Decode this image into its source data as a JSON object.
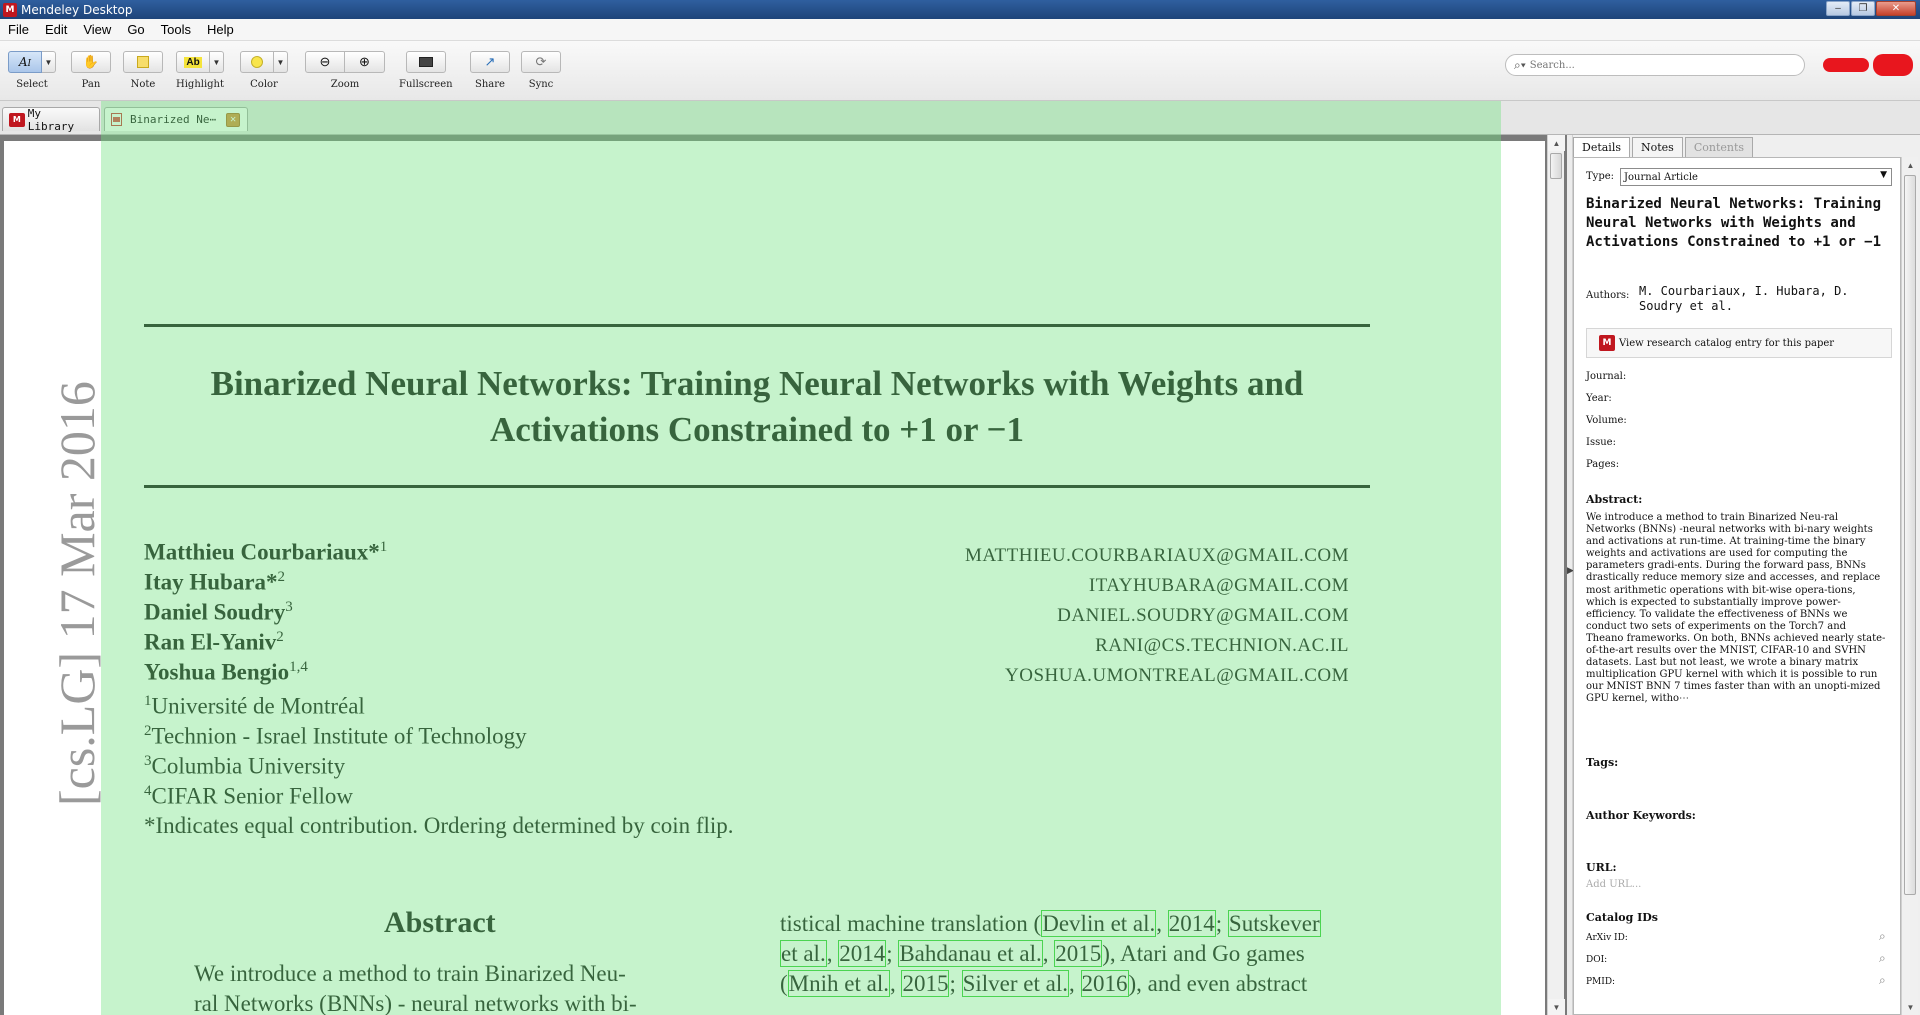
{
  "window": {
    "title": "Mendeley Desktop",
    "app_icon": "mendeley-icon"
  },
  "menu": [
    "File",
    "Edit",
    "View",
    "Go",
    "Tools",
    "Help"
  ],
  "toolbar": {
    "select": "Select",
    "pan": "Pan",
    "note": "Note",
    "highlight": "Highlight",
    "color": "Color",
    "zoom": "Zoom",
    "fullscreen": "Fullscreen",
    "share": "Share",
    "sync": "Sync",
    "search_placeholder": "Search..."
  },
  "tabs": [
    {
      "label": "My Library",
      "active": false
    },
    {
      "label": "Binarized Ne⋯",
      "active": true
    }
  ],
  "document": {
    "title_line1": "Binarized Neural Networks: Training Neural Networks with Weights and",
    "title_line2": "Activations Constrained to +1 or −1",
    "authors": [
      {
        "name": "Matthieu Courbariaux*",
        "sup": "1",
        "email": "MATTHIEU.COURBARIAUX@GMAIL.COM"
      },
      {
        "name": "Itay Hubara*",
        "sup": "2",
        "email": "ITAYHUBARA@GMAIL.COM"
      },
      {
        "name": "Daniel Soudry",
        "sup": "3",
        "email": "DANIEL.SOUDRY@GMAIL.COM"
      },
      {
        "name": "Ran El-Yaniv",
        "sup": "2",
        "email": "RANI@CS.TECHNION.AC.IL"
      },
      {
        "name": "Yoshua Bengio",
        "sup": "1,4",
        "email": "YOSHUA.UMONTREAL@GMAIL.COM"
      }
    ],
    "affiliations": [
      {
        "sup": "1",
        "text": "Université de Montréal"
      },
      {
        "sup": "2",
        "text": "Technion - Israel Institute of Technology"
      },
      {
        "sup": "3",
        "text": "Columbia University"
      },
      {
        "sup": "4",
        "text": "CIFAR Senior Fellow"
      },
      {
        "sup": "",
        "text": "*Indicates equal contribution. Ordering determined by coin flip."
      }
    ],
    "abstract_heading": "Abstract",
    "abstract_line1": "We introduce a method to train Binarized Neu-",
    "abstract_line2": "ral Networks (BNNs) - neural networks with bi-",
    "right_col": {
      "l1_a": "tistical machine translation (",
      "l1_c1": "Devlin et al.",
      "l1_sep1": ", ",
      "l1_c2": "2014",
      "l1_sep2": "; ",
      "l1_c3": "Sutskever",
      "l2_c1": "et al.",
      "l2_sep1": ", ",
      "l2_c2": "2014",
      "l2_sep2": "; ",
      "l2_c3": "Bahdanau et al.",
      "l2_sep3": ", ",
      "l2_c4": "2015",
      "l2_tail": "), Atari and Go games",
      "l3_a": "(",
      "l3_c1": "Mnih et al.",
      "l3_sep1": ", ",
      "l3_c2": "2015",
      "l3_sep2": "; ",
      "l3_c3": "Silver et al.",
      "l3_sep3": ", ",
      "l3_c4": "2016",
      "l3_tail": "), and even abstract"
    },
    "arxiv_stamp": "[cs.LG]  17 Mar 2016"
  },
  "panel": {
    "tabs": [
      "Details",
      "Notes",
      "Contents"
    ],
    "type_label": "Type:",
    "type_value": "Journal Article",
    "title": "Binarized Neural Networks: Training Neural Networks with Weights and Activations Constrained to +1 or −1",
    "authors_label": "Authors:",
    "authors_value": "M. Courbariaux, I. Hubara, D. Soudry et al.",
    "catalog_button": "View research catalog entry for this paper",
    "journal_label": "Journal:",
    "year_label": "Year:",
    "volume_label": "Volume:",
    "issue_label": "Issue:",
    "pages_label": "Pages:",
    "abstract_label": "Abstract:",
    "abstract_text": "We introduce a method to train Binarized Neu-ral Networks (BNNs) -neural networks with bi-nary weights and activations at run-time. At training-time the binary weights and activations are used for computing the parameters gradi-ents. During the forward pass, BNNs drastically reduce memory size and accesses, and replace most arithmetic operations with bit-wise opera-tions, which is expected to substantially improve power-efficiency. To validate the effectiveness of BNNs we conduct two sets of experiments on the Torch7 and Theano frameworks. On both, BNNs achieved nearly state-of-the-art results over the MNIST, CIFAR-10 and SVHN datasets. Last but not least, we wrote a binary matrix multiplication GPU kernel with which it is possible to run our MNIST BNN 7 times faster than with an unopti-mized GPU kernel, witho⋯",
    "tags_label": "Tags:",
    "keywords_label": "Author Keywords:",
    "url_label": "URL:",
    "url_placeholder": "Add URL...",
    "catalog_label": "Catalog IDs",
    "arxiv_label": "ArXiv ID:",
    "doi_label": "DOI:",
    "pmid_label": "PMID:"
  },
  "colors": {
    "highlight": "#70e080",
    "citation_box": "#33cc33",
    "brand": "#c0171f"
  }
}
